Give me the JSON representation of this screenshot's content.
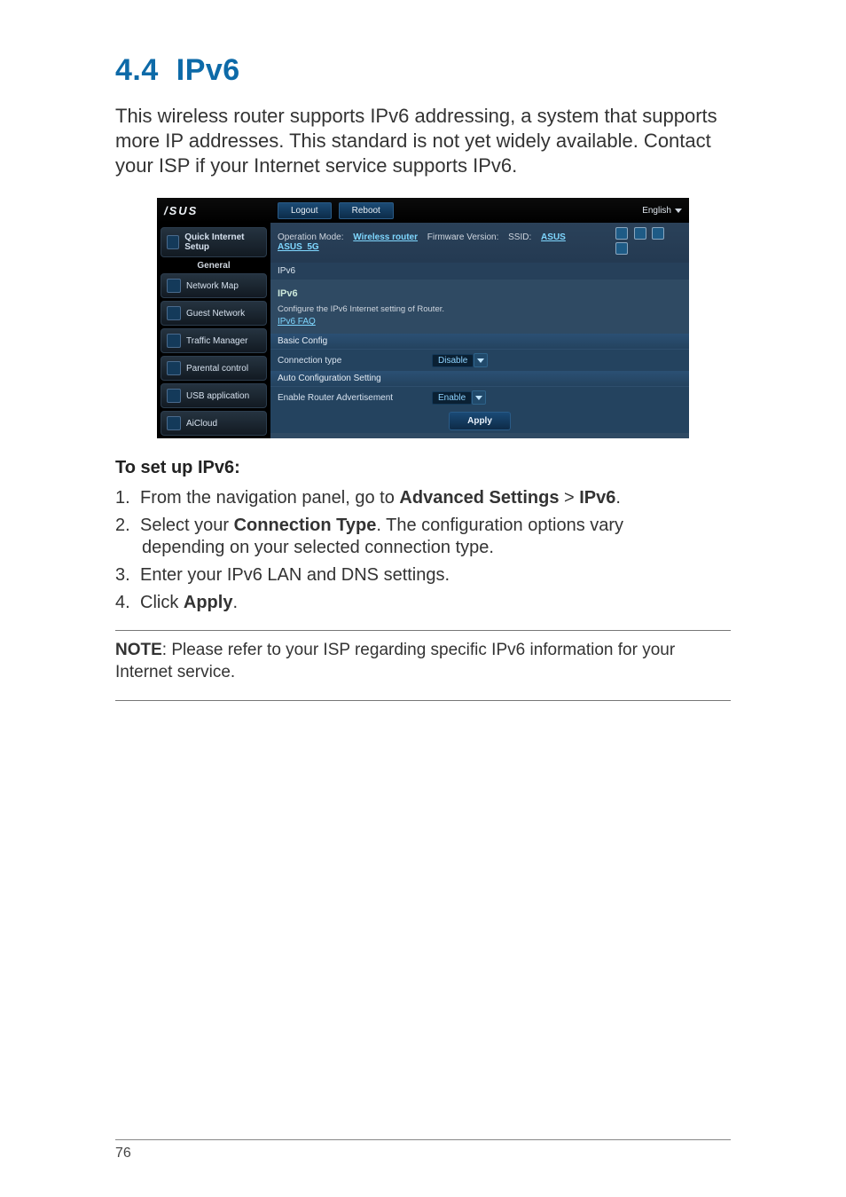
{
  "heading_number": "4.4",
  "heading_title": "IPv6",
  "intro_text": "This wireless router supports IPv6 addressing, a system that supports more IP addresses. This standard is not yet widely available. Contact your ISP if your Internet service supports IPv6.",
  "setup_heading": "To set up IPv6:",
  "steps": {
    "s1_pre": "From the navigation panel, go to ",
    "s1_b1": "Advanced Settings",
    "s1_mid": " > ",
    "s1_b2": "IPv6",
    "s1_post": ".",
    "s2_pre": "Select your ",
    "s2_b1": "Connection Type",
    "s2_post_a": ". The configuration options vary ",
    "s2_post_b": "depending on your selected connection type.",
    "s3": "Enter your IPv6 LAN and DNS settings.",
    "s4_pre": "Click ",
    "s4_b1": "Apply",
    "s4_post": "."
  },
  "note_label": "NOTE",
  "note_text": ": Please refer to your ISP regarding specific IPv6 information for your Internet service.",
  "page_number": "76",
  "router": {
    "logo": "/SUS",
    "logout": "Logout",
    "reboot": "Reboot",
    "language": "English",
    "op_mode_label": "Operation Mode:",
    "op_mode_value": "Wireless router",
    "fw_label": "Firmware Version:",
    "ssid_label": "SSID:",
    "ssid_value": "ASUS  ASUS_5G",
    "breadcrumb": "IPv6",
    "sidebar": {
      "qis": "Quick Internet Setup",
      "general": "General",
      "items": {
        "0": {
          "label": "Network Map"
        },
        "1": {
          "label": "Guest Network"
        },
        "2": {
          "label": "Traffic Manager"
        },
        "3": {
          "label": "Parental control"
        },
        "4": {
          "label": "USB application"
        },
        "5": {
          "label": "AiCloud"
        }
      }
    },
    "panel": {
      "title": "IPv6",
      "desc": "Configure the IPv6 Internet setting of Router.",
      "faq": "IPv6  FAQ",
      "band_basic": "Basic Config",
      "conn_label": "Connection type",
      "conn_value": "Disable",
      "band_auto": "Auto Configuration Setting",
      "adv_label": "Enable Router Advertisement",
      "adv_value": "Enable",
      "apply": "Apply"
    }
  }
}
